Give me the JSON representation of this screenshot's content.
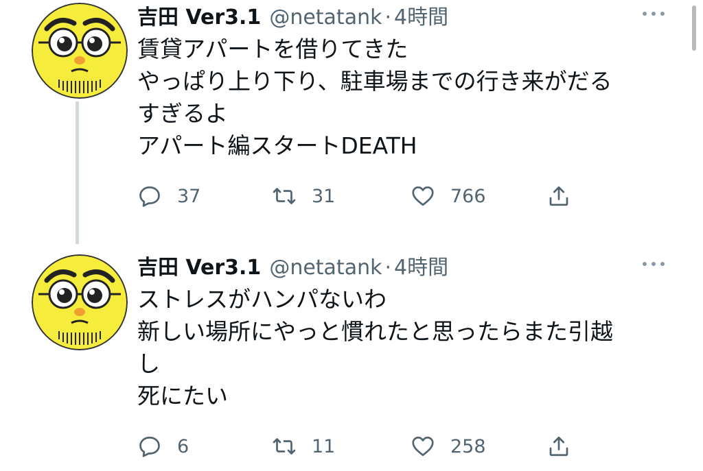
{
  "tweets": [
    {
      "name": "吉田 Ver3.1",
      "handle": "@netatank",
      "dot": "·",
      "time": "4時間",
      "lines": [
        "賃貸アパートを借りてきた",
        "やっぱり上り下り、駐車場までの行き来がだる",
        "すぎるよ",
        "アパート編スタートDEATH"
      ],
      "replies": "37",
      "retweets": "31",
      "likes": "766",
      "avatar": "avatar-icon"
    },
    {
      "name": "吉田 Ver3.1",
      "handle": "@netatank",
      "dot": "·",
      "time": "4時間",
      "lines": [
        "ストレスがハンパないわ",
        "新しい場所にやっと慣れたと思ったらまた引越",
        "し",
        "死にたい"
      ],
      "replies": "6",
      "retweets": "11",
      "likes": "258",
      "avatar": "avatar-icon"
    }
  ],
  "colors": {
    "text": "#0f1419",
    "secondary": "#536471",
    "thread_line": "#cfd9de",
    "avatar_face": "#f6ec3c"
  }
}
